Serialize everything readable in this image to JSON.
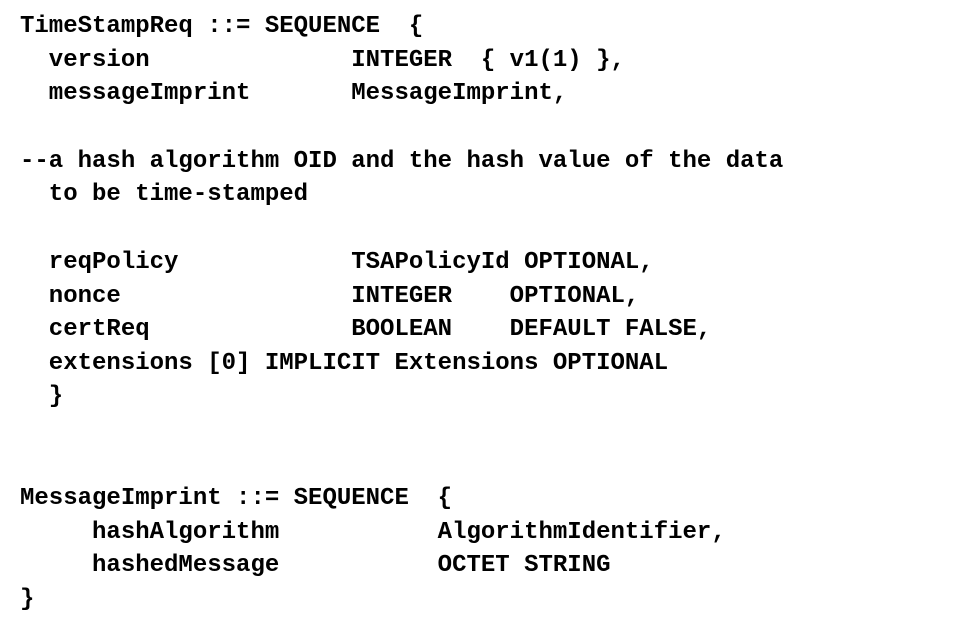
{
  "block1": {
    "l1": "TimeStampReq ::= SEQUENCE  {",
    "l2": "  version              INTEGER  { v1(1) },",
    "l3": "  messageImprint       MessageImprint,"
  },
  "block2": {
    "l1": "--a hash algorithm OID and the hash value of the data",
    "l2": "  to be time-stamped"
  },
  "block3": {
    "l1": "  reqPolicy            TSAPolicyId OPTIONAL,",
    "l2": "  nonce                INTEGER    OPTIONAL,",
    "l3": "  certReq              BOOLEAN    DEFAULT FALSE,",
    "l4": "  extensions [0] IMPLICIT Extensions OPTIONAL",
    "l5": "  }"
  },
  "block4": {
    "l1": "MessageImprint ::= SEQUENCE  {",
    "l2": "     hashAlgorithm           AlgorithmIdentifier,",
    "l3": "     hashedMessage           OCTET STRING",
    "l4": "}"
  }
}
